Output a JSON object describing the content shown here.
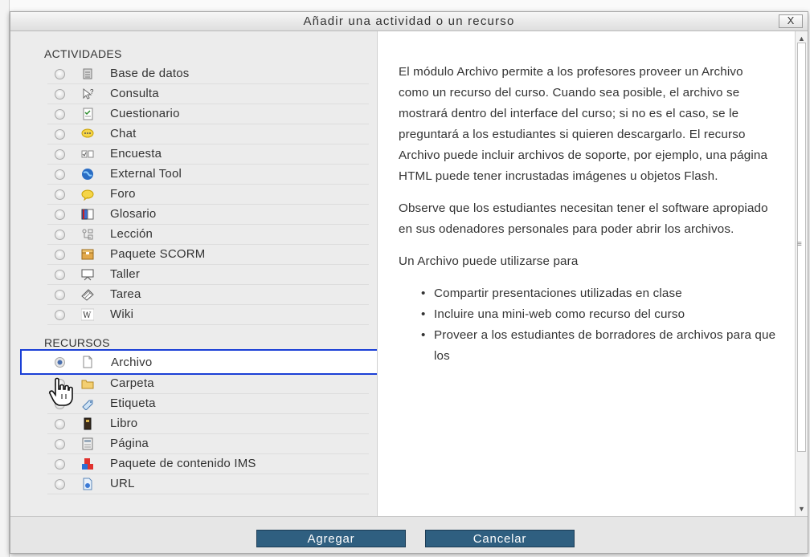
{
  "dialog": {
    "title": "Añadir una actividad o un recurso",
    "close_label": "X"
  },
  "activities": {
    "heading": "ACTIVIDADES",
    "items": [
      {
        "label": "Base de datos",
        "icon": "database-icon"
      },
      {
        "label": "Consulta",
        "icon": "choice-icon"
      },
      {
        "label": "Cuestionario",
        "icon": "quiz-icon"
      },
      {
        "label": "Chat",
        "icon": "chat-icon"
      },
      {
        "label": "Encuesta",
        "icon": "survey-icon"
      },
      {
        "label": "External Tool",
        "icon": "external-tool-icon"
      },
      {
        "label": "Foro",
        "icon": "forum-icon"
      },
      {
        "label": "Glosario",
        "icon": "glossary-icon"
      },
      {
        "label": "Lección",
        "icon": "lesson-icon"
      },
      {
        "label": "Paquete SCORM",
        "icon": "scorm-package-icon"
      },
      {
        "label": "Taller",
        "icon": "workshop-icon"
      },
      {
        "label": "Tarea",
        "icon": "assignment-icon"
      },
      {
        "label": "Wiki",
        "icon": "wiki-icon"
      }
    ]
  },
  "resources": {
    "heading": "RECURSOS",
    "items": [
      {
        "label": "Archivo",
        "icon": "file-icon",
        "selected": true
      },
      {
        "label": "Carpeta",
        "icon": "folder-icon"
      },
      {
        "label": "Etiqueta",
        "icon": "label-icon"
      },
      {
        "label": "Libro",
        "icon": "book-icon"
      },
      {
        "label": "Página",
        "icon": "page-icon"
      },
      {
        "label": "Paquete de contenido IMS",
        "icon": "ims-package-icon"
      },
      {
        "label": "URL",
        "icon": "url-icon"
      }
    ]
  },
  "help": {
    "p1": "El módulo Archivo permite a los profesores proveer un Archivo como un recurso del curso. Cuando sea posible, el archivo se mostrará dentro del interface del curso; si no es el caso, se le preguntará a los estudiantes si quieren descargarlo. El recurso Archivo puede incluir archivos de soporte, por ejemplo, una página HTML puede tener incrustadas imágenes u objetos Flash.",
    "p2": "Observe que los estudiantes necesitan tener el software apropiado en sus odenadores personales para poder abrir los archivos.",
    "p3": "Un Archivo puede utilizarse para",
    "bullets": [
      "Compartir presentaciones utilizadas en clase",
      "Incluire una mini-web como recurso del curso",
      "Proveer a los estudiantes de borradores de archivos para que los"
    ]
  },
  "footer": {
    "add_label": "Agregar",
    "cancel_label": "Cancelar"
  },
  "colors": {
    "selection_border": "#1a3fd6",
    "button_bg": "#2f5f80"
  }
}
